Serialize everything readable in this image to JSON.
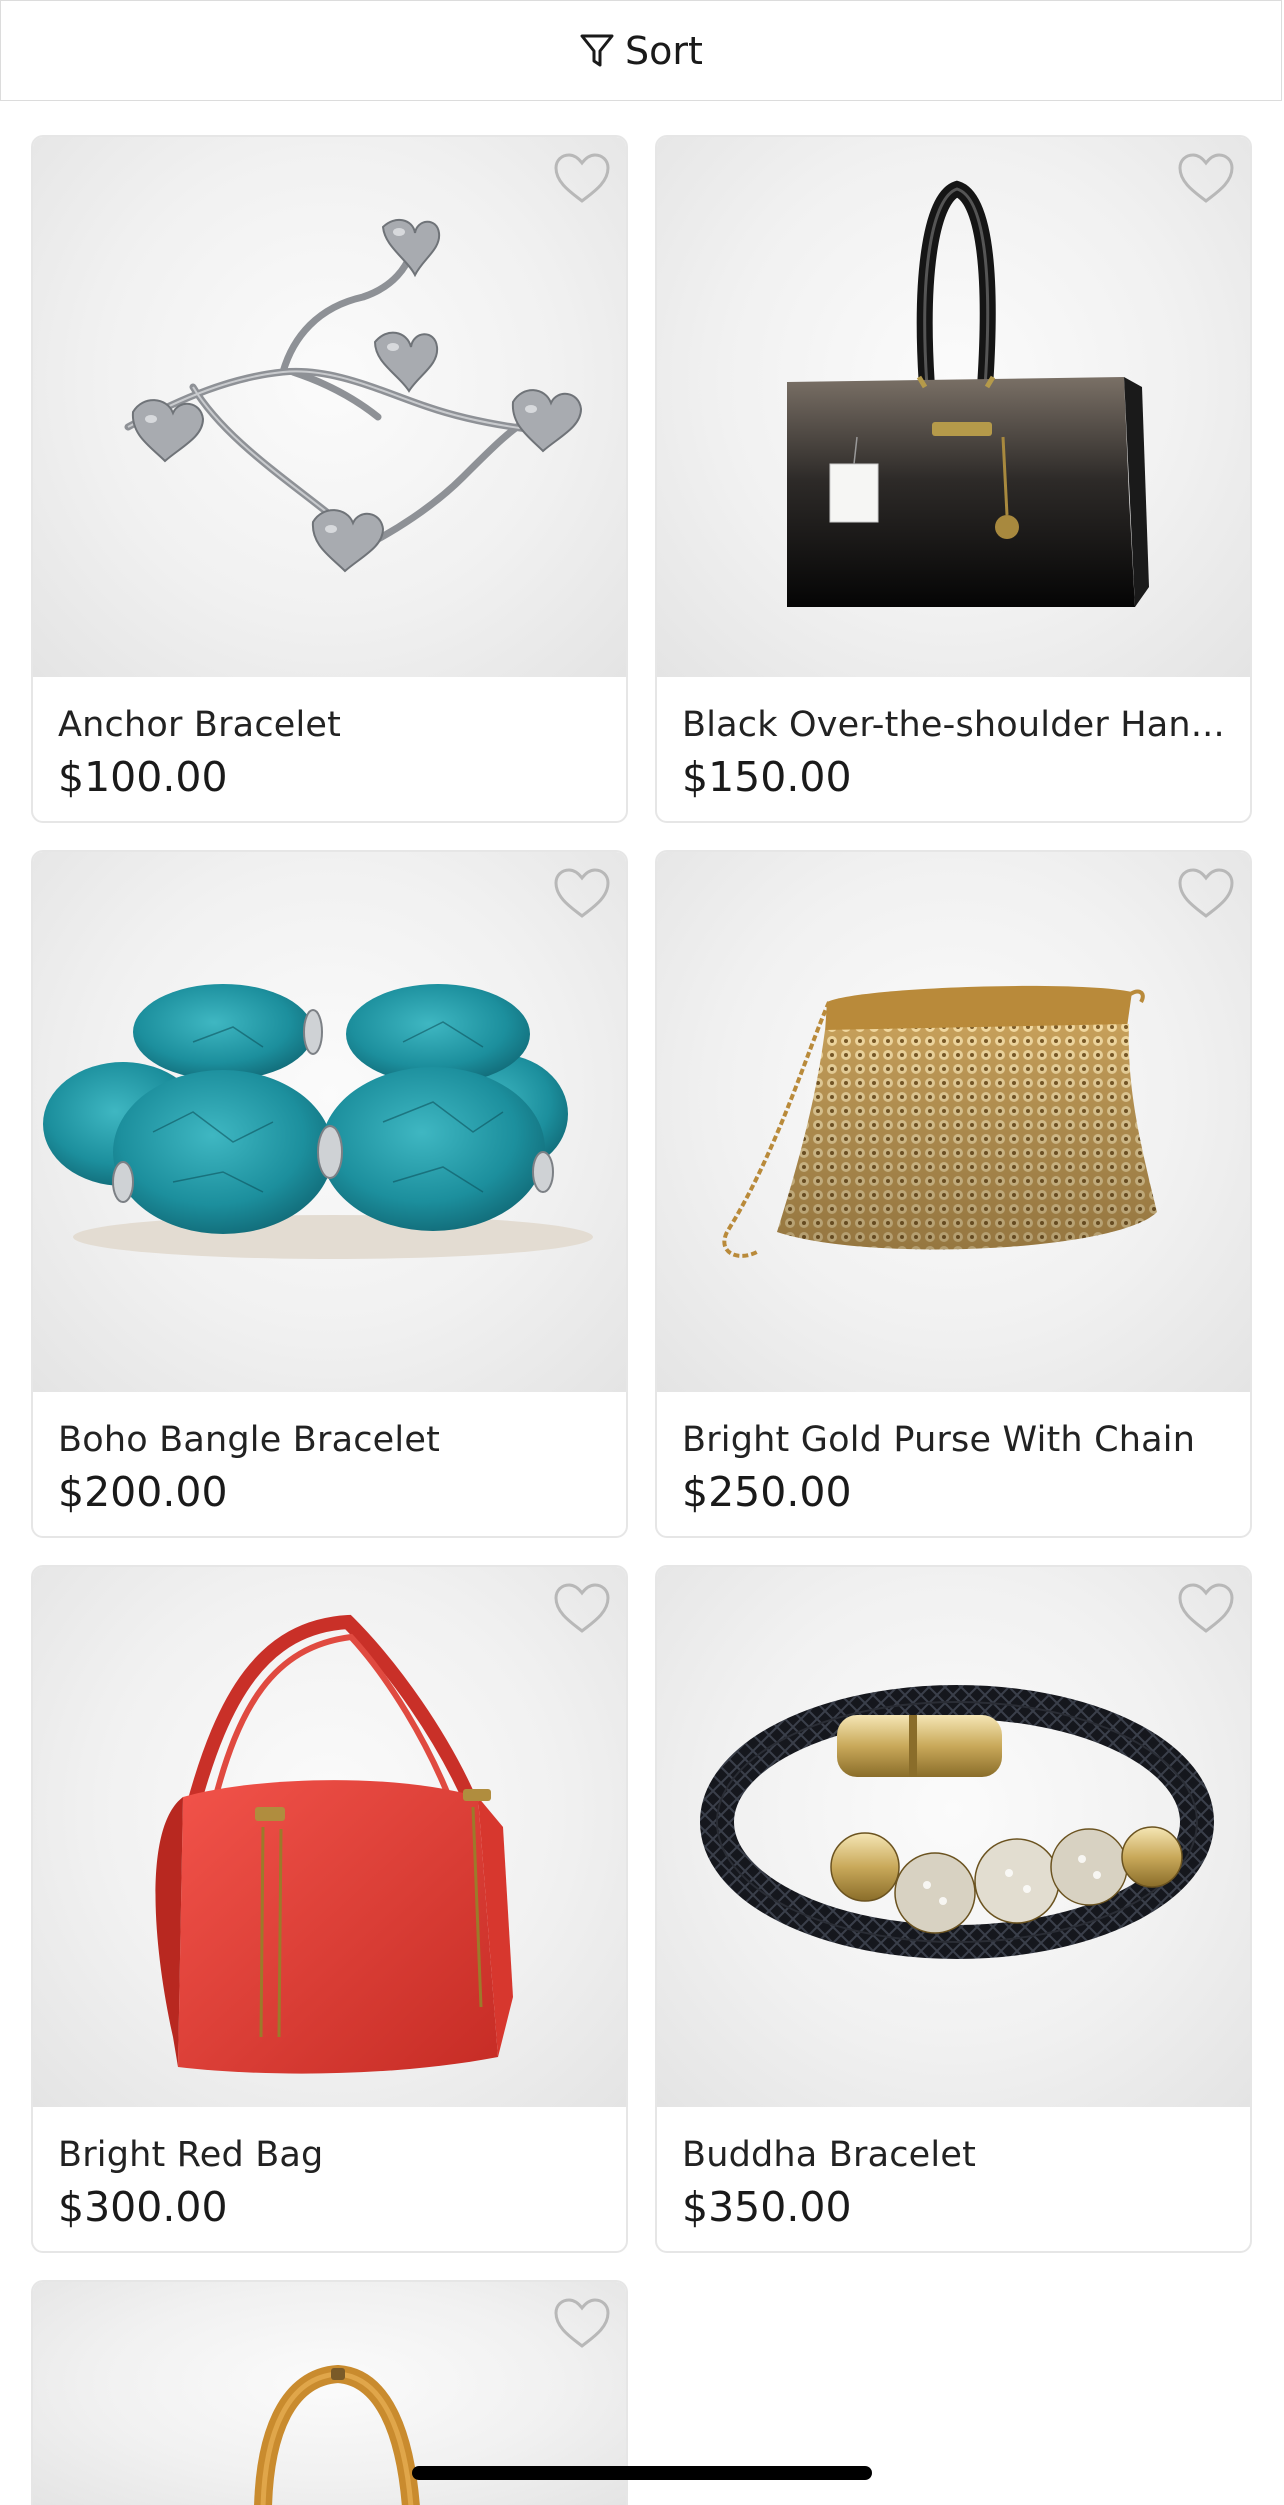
{
  "toolbar": {
    "sort_label": "Sort",
    "sort_icon": "filter-icon"
  },
  "favorite_icon": "heart-outline-icon",
  "products": [
    {
      "name": "Anchor Bracelet",
      "price": "$100.00",
      "image": "silver heart charm bracelet"
    },
    {
      "name": "Black Over-the-shoulder Han...",
      "price": "$150.00",
      "image": "black patent handbag"
    },
    {
      "name": "Boho Bangle Bracelet",
      "price": "$200.00",
      "image": "turquoise bangle bracelet"
    },
    {
      "name": "Bright Gold Purse With Chain",
      "price": "$250.00",
      "image": "gold mesh purse"
    },
    {
      "name": "Bright Red Bag",
      "price": "$300.00",
      "image": "red shoulder bag"
    },
    {
      "name": "Buddha Bracelet",
      "price": "$350.00",
      "image": "black braided bracelet with beads"
    },
    {
      "name": "",
      "price": "",
      "image": "tan bag handle"
    }
  ]
}
